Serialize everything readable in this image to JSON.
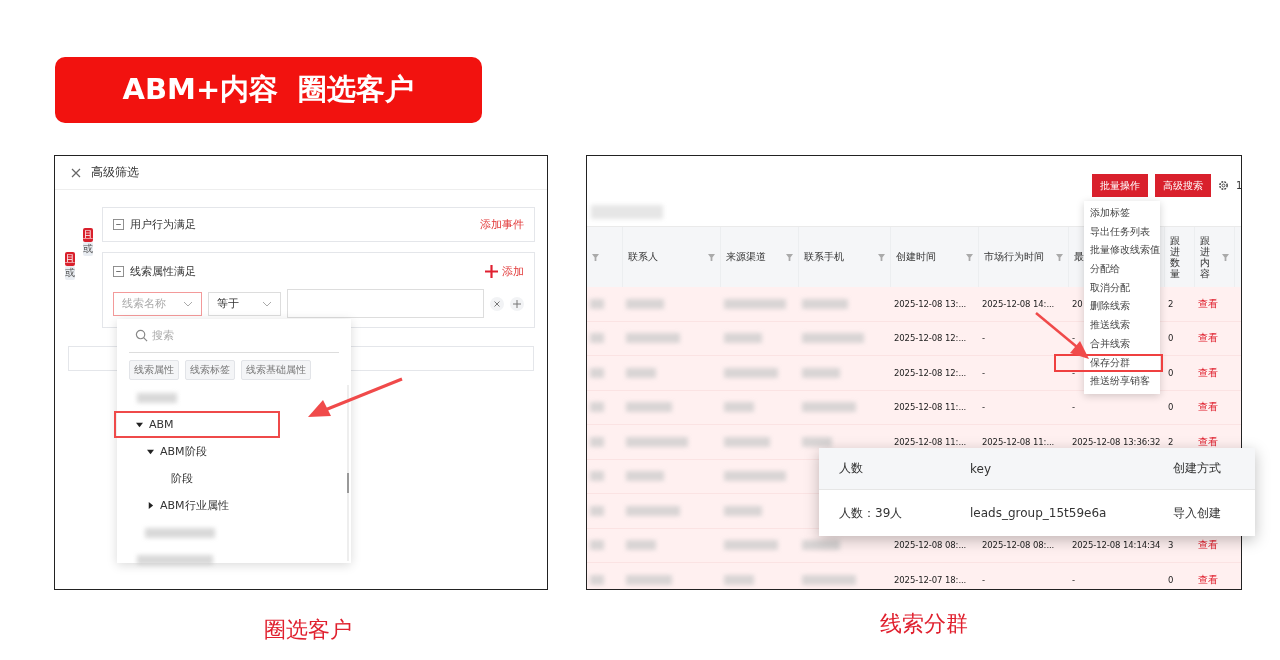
{
  "banner": {
    "title": "ABM+内容  圈选客户"
  },
  "left_panel": {
    "title": "高级筛选",
    "logic_outer": [
      {
        "label": "且",
        "selected": true
      },
      {
        "label": "或",
        "selected": false
      }
    ],
    "logic_inner": [
      {
        "label": "且",
        "selected": true
      },
      {
        "label": "或",
        "selected": false
      }
    ],
    "groups": [
      {
        "title": "用户行为满足",
        "action": "添加事件",
        "kind": "plain"
      },
      {
        "title": "线索属性满足",
        "action": "添加",
        "kind": "iconed",
        "condition": {
          "field_placeholder": "线索名称",
          "operator": "等于"
        }
      }
    ],
    "dropdown": {
      "search_placeholder": "搜索",
      "tabs": [
        "线索属性",
        "线索标签",
        "线索基础属性"
      ],
      "tree": [
        {
          "kind": "redacted"
        },
        {
          "kind": "node",
          "label": "ABM",
          "expanded": true,
          "highlighted": true,
          "children": [
            {
              "kind": "node",
              "label": "ABM阶段",
              "expanded": true,
              "highlighted": false,
              "children": [
                {
                  "kind": "leaf",
                  "label": "阶段",
                  "highlighted": false
                }
              ]
            },
            {
              "kind": "node",
              "label": "ABM行业属性",
              "expanded": false,
              "highlighted": false
            }
          ]
        },
        {
          "kind": "redacted"
        },
        {
          "kind": "redacted"
        }
      ]
    },
    "caption": "圈选客户"
  },
  "right_panel": {
    "toolbar": {
      "buttons": [
        "批量操作",
        "高级搜索"
      ],
      "cut_text": "1"
    },
    "menu": [
      {
        "label": "添加标签",
        "highlighted": false
      },
      {
        "label": "导出任务列表",
        "highlighted": false
      },
      {
        "label": "批量修改线索值",
        "highlighted": false
      },
      {
        "label": "分配给",
        "highlighted": false
      },
      {
        "label": "取消分配",
        "highlighted": false
      },
      {
        "label": "删除线索",
        "highlighted": false
      },
      {
        "label": "推送线索",
        "highlighted": false
      },
      {
        "label": "合并线索",
        "highlighted": false
      },
      {
        "label": "保存分群",
        "highlighted": true
      },
      {
        "label": "推送纷享销客",
        "highlighted": false
      }
    ],
    "table": {
      "columns": [
        {
          "label": "联系人",
          "kind": "plain"
        },
        {
          "label": "来源渠道",
          "kind": "plain"
        },
        {
          "label": "联系手机",
          "kind": "plain"
        },
        {
          "label": "创建时间",
          "kind": "plain"
        },
        {
          "label": "市场行为时间",
          "kind": "plain"
        },
        {
          "label": "最",
          "kind": "plain"
        },
        {
          "label": "跟进数量",
          "kind": "vertical"
        },
        {
          "label": "跟进内容",
          "kind": "vertical"
        }
      ],
      "rows": [
        {
          "kind": "data",
          "cells": [
            "2025-12-08 13:...",
            "2025-12-08 14:...",
            "20",
            "2",
            "查看"
          ]
        },
        {
          "kind": "data",
          "cells": [
            "2025-12-08 12:...",
            "-",
            "-",
            "0",
            "查看"
          ]
        },
        {
          "kind": "data",
          "cells": [
            "2025-12-08 12:...",
            "-",
            "-",
            "0",
            "查看"
          ]
        },
        {
          "kind": "data",
          "cells": [
            "2025-12-08 11:...",
            "-",
            "-",
            "0",
            "查看"
          ]
        },
        {
          "kind": "data",
          "cells": [
            "2025-12-08 11:...",
            "2025-12-08 11:...",
            "2025-12-08 13:36:32",
            "2",
            "查看"
          ]
        },
        {
          "kind": "covered"
        },
        {
          "kind": "covered"
        },
        {
          "kind": "data",
          "cells": [
            "2025-12-08 08:...",
            "2025-12-08 08:...",
            "2025-12-08 14:14:34",
            "3",
            "查看"
          ]
        },
        {
          "kind": "data",
          "cells": [
            "2025-12-07 18:...",
            "-",
            "-",
            "0",
            "查看"
          ]
        }
      ]
    },
    "popup": {
      "columns": [
        "人数",
        "key",
        "创建方式"
      ],
      "rows": [
        [
          "人数：39人",
          "leads_group_15t59e6a",
          "导入创建"
        ]
      ]
    },
    "caption": "线索分群"
  }
}
